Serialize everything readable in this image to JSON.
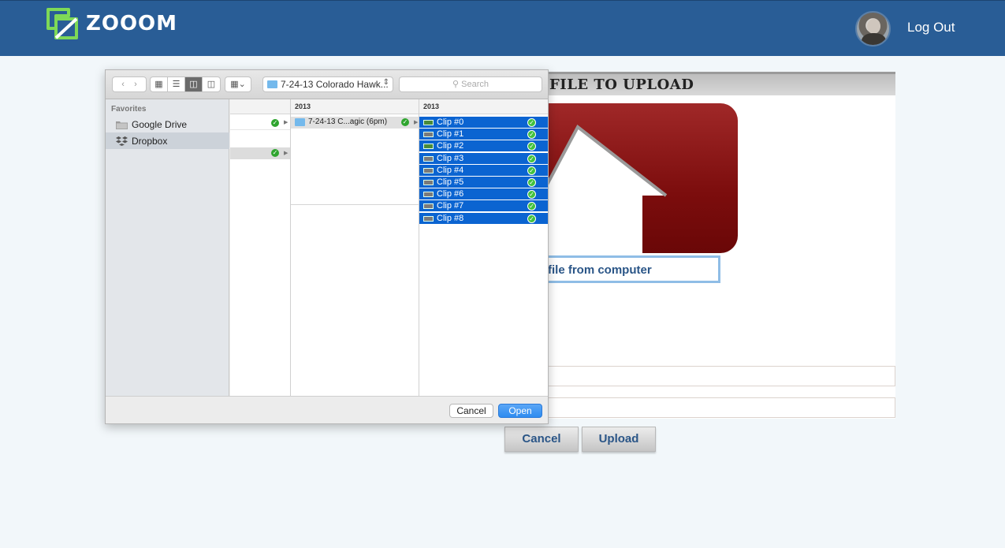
{
  "header": {
    "brand": "ZOOOM",
    "logout_label": "Log Out",
    "colors": {
      "bar": "#295d96",
      "text": "#ffffff"
    }
  },
  "page": {
    "title": "FILE TO UPLOAD",
    "from_computer_label": "file from computer",
    "cancel_label": "Cancel",
    "upload_label": "Upload"
  },
  "dialog": {
    "path_label": "7-24-13 Colorado Hawk...",
    "search_placeholder": "Search",
    "sidebar": {
      "title": "Favorites",
      "items": [
        {
          "label": "Google Drive",
          "icon": "folder-icon",
          "selected": false
        },
        {
          "label": "Dropbox",
          "icon": "dropbox-icon",
          "selected": true
        }
      ]
    },
    "column2": {
      "header": "2013",
      "folder_label": "7-24-13 C...agic (6pm)"
    },
    "column3": {
      "header": "2013",
      "clips": [
        {
          "label": "Clip #0",
          "thumb": "green"
        },
        {
          "label": "Clip #1",
          "thumb": "gray"
        },
        {
          "label": "Clip #2",
          "thumb": "green"
        },
        {
          "label": "Clip #3",
          "thumb": "gray"
        },
        {
          "label": "Clip #4",
          "thumb": "gray"
        },
        {
          "label": "Clip #5",
          "thumb": "gray"
        },
        {
          "label": "Clip #6",
          "thumb": "gray"
        },
        {
          "label": "Clip #7",
          "thumb": "gray"
        },
        {
          "label": "Clip #8",
          "thumb": "gray"
        }
      ]
    },
    "cancel_label": "Cancel",
    "open_label": "Open",
    "colors": {
      "selection": "#0b64d1",
      "primary_button": "#2e8cf0"
    }
  }
}
